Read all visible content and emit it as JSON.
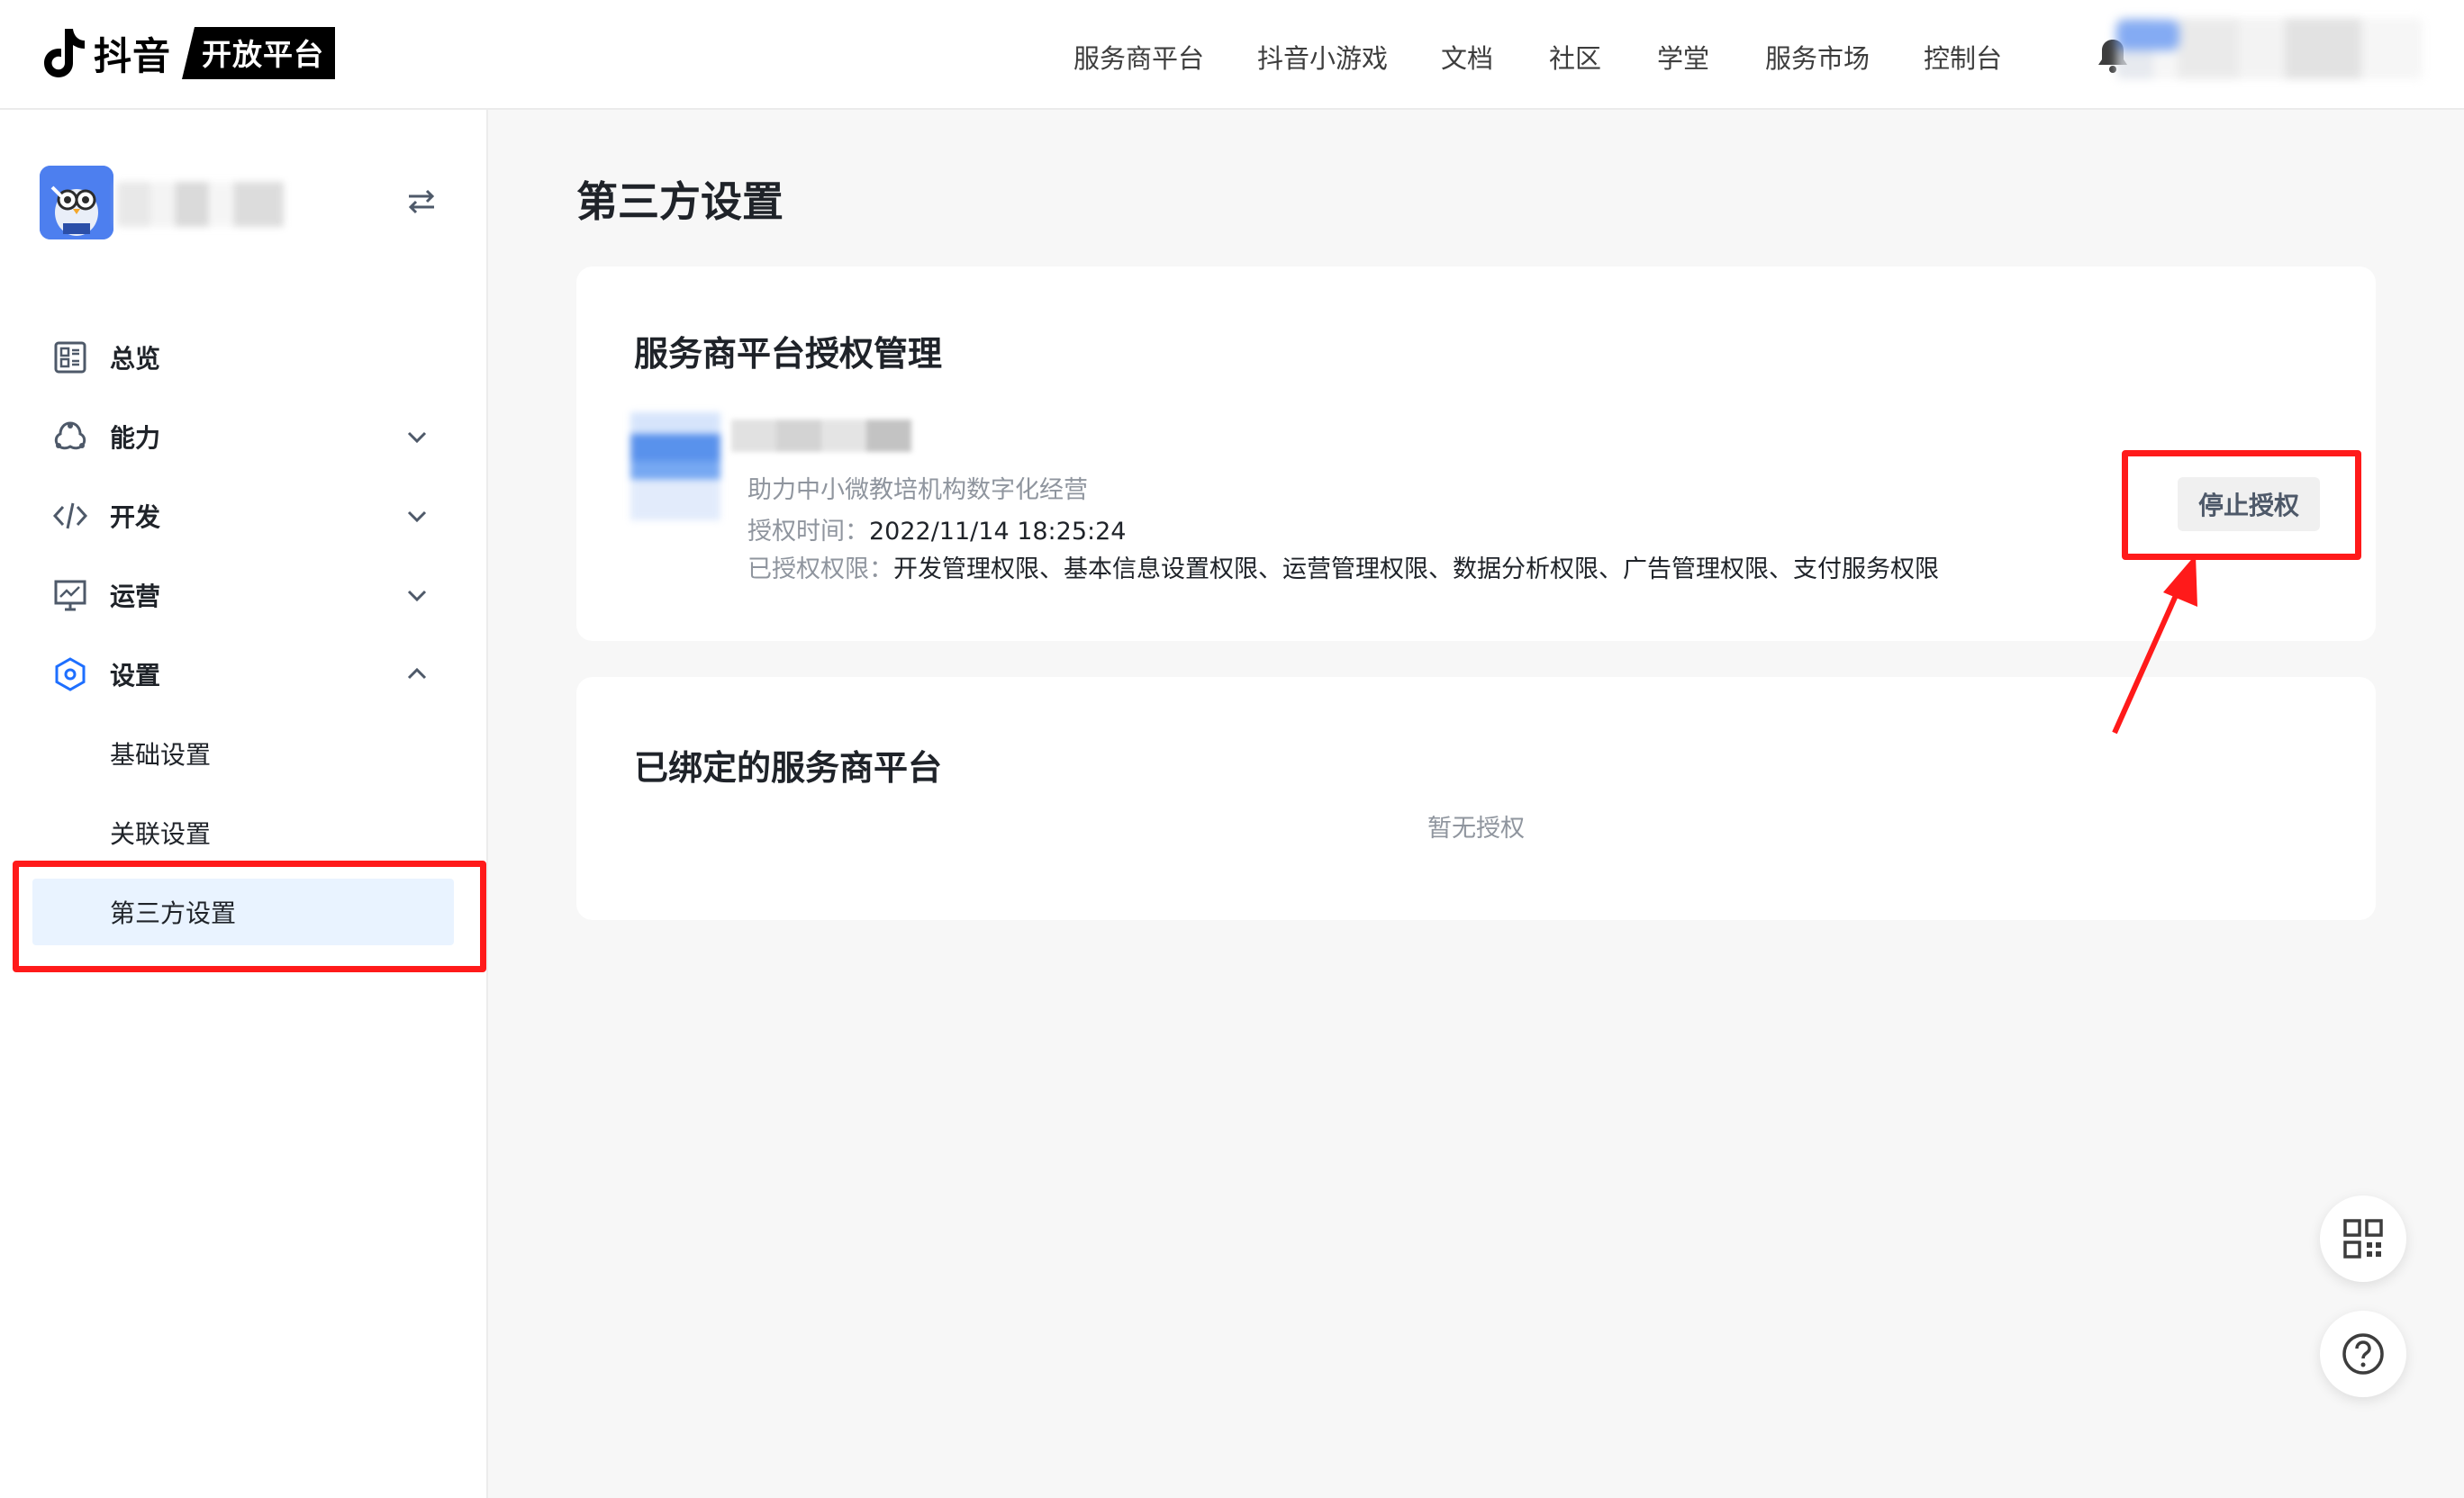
{
  "header": {
    "logo_text": "抖音",
    "logo_badge": "开放平台",
    "nav": [
      "服务商平台",
      "抖音小游戏",
      "文档",
      "社区",
      "学堂",
      "服务市场",
      "控制台"
    ]
  },
  "sidebar": {
    "menu": [
      {
        "label": "总览",
        "icon": "overview-icon"
      },
      {
        "label": "能力",
        "icon": "capability-icon"
      },
      {
        "label": "开发",
        "icon": "code-icon"
      },
      {
        "label": "运营",
        "icon": "operation-chart-icon"
      },
      {
        "label": "设置",
        "icon": "settings-hexagon-icon"
      }
    ],
    "submenu": [
      "基础设置",
      "关联设置",
      "第三方设置"
    ],
    "active_submenu": "第三方设置"
  },
  "main": {
    "page_title": "第三方设置",
    "auth_card": {
      "title": "服务商平台授权管理",
      "provider_desc": "助力中小微教培机构数字化经营",
      "auth_time_label": "授权时间：",
      "auth_time": "2022/11/14 18:25:24",
      "permissions_label": "已授权权限：",
      "permissions": "开发管理权限、基本信息设置权限、运营管理权限、数据分析权限、广告管理权限、支付服务权限",
      "stop_button": "停止授权"
    },
    "bound_card": {
      "title": "已绑定的服务商平台",
      "empty_text": "暂无授权"
    }
  },
  "colors": {
    "accent_active_bg": "#e9f3ff",
    "highlight_red": "#ff1a1a",
    "settings_icon_blue": "#1e6fff"
  }
}
